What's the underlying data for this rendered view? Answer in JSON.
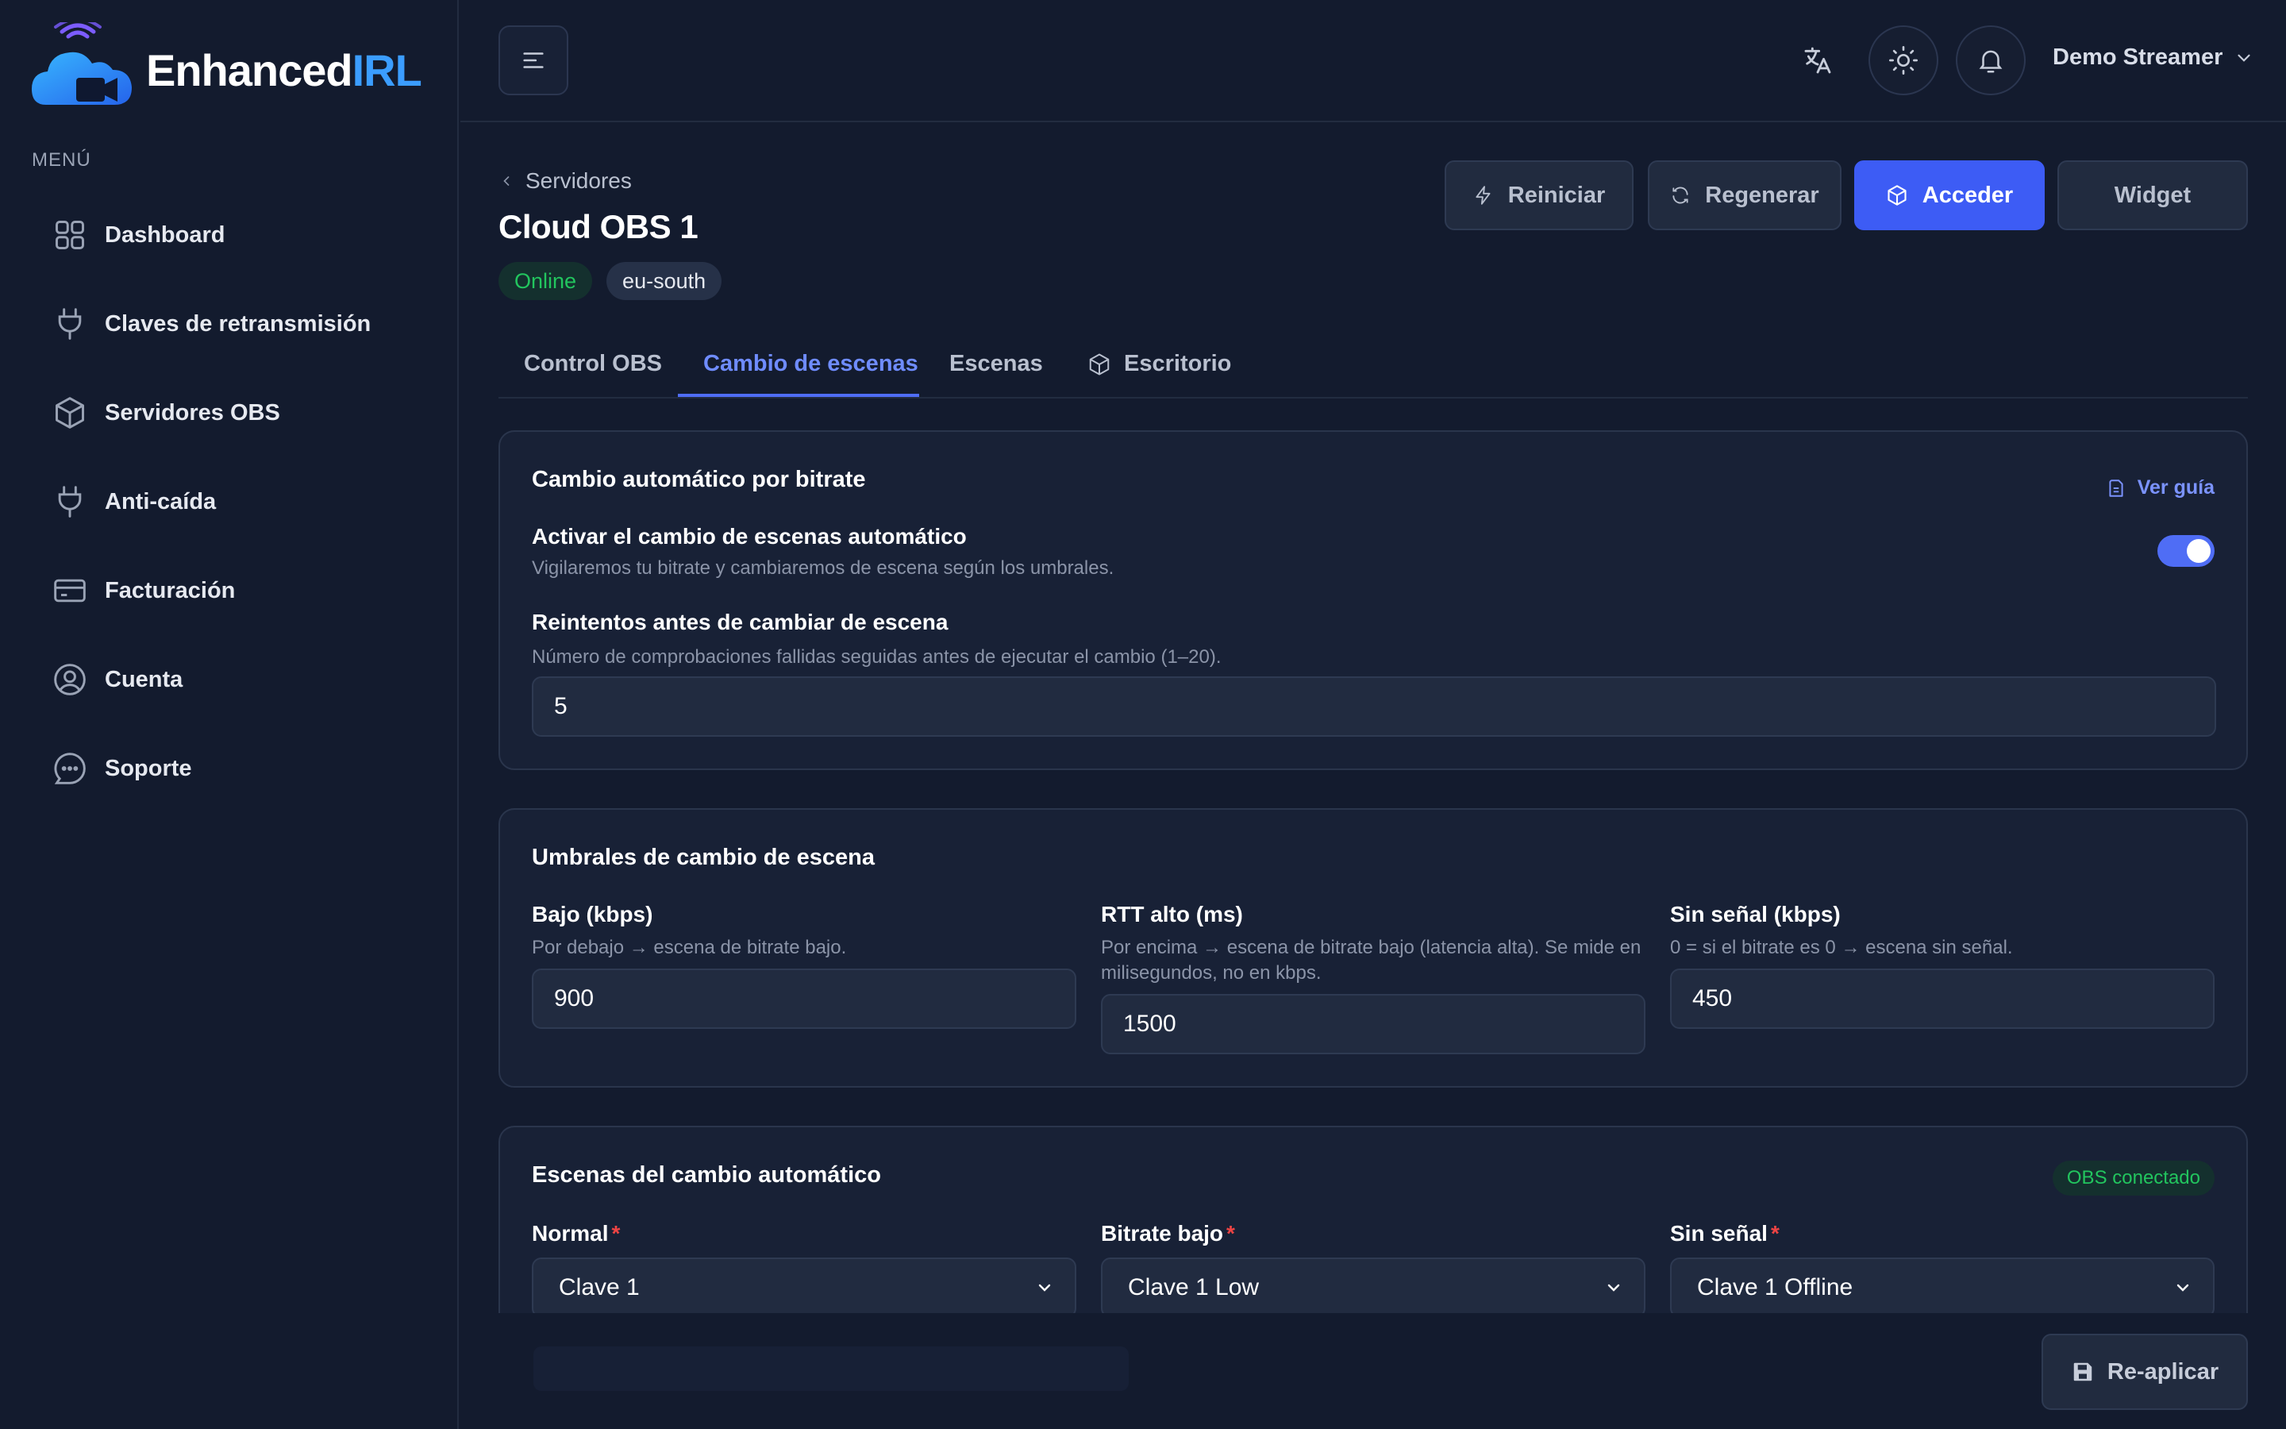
{
  "brand": {
    "name_part1": "Enhanced",
    "name_part2": "IRL"
  },
  "sidebar": {
    "menu_label": "MENÚ",
    "items": [
      {
        "label": "Dashboard",
        "icon": "grid-icon"
      },
      {
        "label": "Claves de retransmisión",
        "icon": "plug-icon"
      },
      {
        "label": "Servidores OBS",
        "icon": "box-icon"
      },
      {
        "label": "Anti-caída",
        "icon": "plug-icon"
      },
      {
        "label": "Facturación",
        "icon": "credit-card-icon"
      },
      {
        "label": "Cuenta",
        "icon": "user-circle-icon"
      },
      {
        "label": "Soporte",
        "icon": "chat-icon"
      }
    ]
  },
  "topbar": {
    "user_name": "Demo Streamer"
  },
  "page": {
    "breadcrumb": "Servidores",
    "title": "Cloud OBS 1",
    "status_badge": "Online",
    "region_badge": "eu-south",
    "actions": {
      "restart": "Reiniciar",
      "regenerate": "Regenerar",
      "access": "Acceder",
      "widget": "Widget"
    }
  },
  "tabs": [
    {
      "label": "Control OBS"
    },
    {
      "label": "Cambio de escenas",
      "active": true
    },
    {
      "label": "Escenas"
    },
    {
      "label": "Escritorio"
    }
  ],
  "auto_switch": {
    "title": "Cambio automático por bitrate",
    "guide_link": "Ver guía",
    "enable_label": "Activar el cambio de escenas automático",
    "enable_help": "Vigilaremos tu bitrate y cambiaremos de escena según los umbrales.",
    "enabled": true,
    "retries_label": "Reintentos antes de cambiar de escena",
    "retries_help": "Número de comprobaciones fallidas seguidas antes de ejecutar el cambio (1–20).",
    "retries_value": "5"
  },
  "thresholds": {
    "title": "Umbrales de cambio de escena",
    "low_label": "Bajo (kbps)",
    "low_help": "Por debajo → escena de bitrate bajo.",
    "low_value": "900",
    "rtt_label": "RTT alto (ms)",
    "rtt_help_line1": "Por encima → escena de bitrate bajo (latencia alta). Se mide en",
    "rtt_help_line2": "milisegundos, no en kbps.",
    "rtt_value": "1500",
    "nosignal_label": "Sin señal (kbps)",
    "nosignal_help": "0 = si el bitrate es 0 → escena sin señal.",
    "nosignal_value": "450"
  },
  "scenes": {
    "title": "Escenas del cambio automático",
    "obs_status": "OBS conectado",
    "normal_label": "Normal",
    "normal_value": "Clave 1",
    "low_label": "Bitrate bajo",
    "low_value": "Clave 1 Low",
    "nosignal_label": "Sin señal",
    "nosignal_value": "Clave 1 Offline",
    "required_mark": "*"
  },
  "footer": {
    "reapply": "Re-aplicar"
  },
  "colors": {
    "accent": "#3d5cf5",
    "online": "#22c55e",
    "required": "#ef4444",
    "background": "#131b2e"
  }
}
